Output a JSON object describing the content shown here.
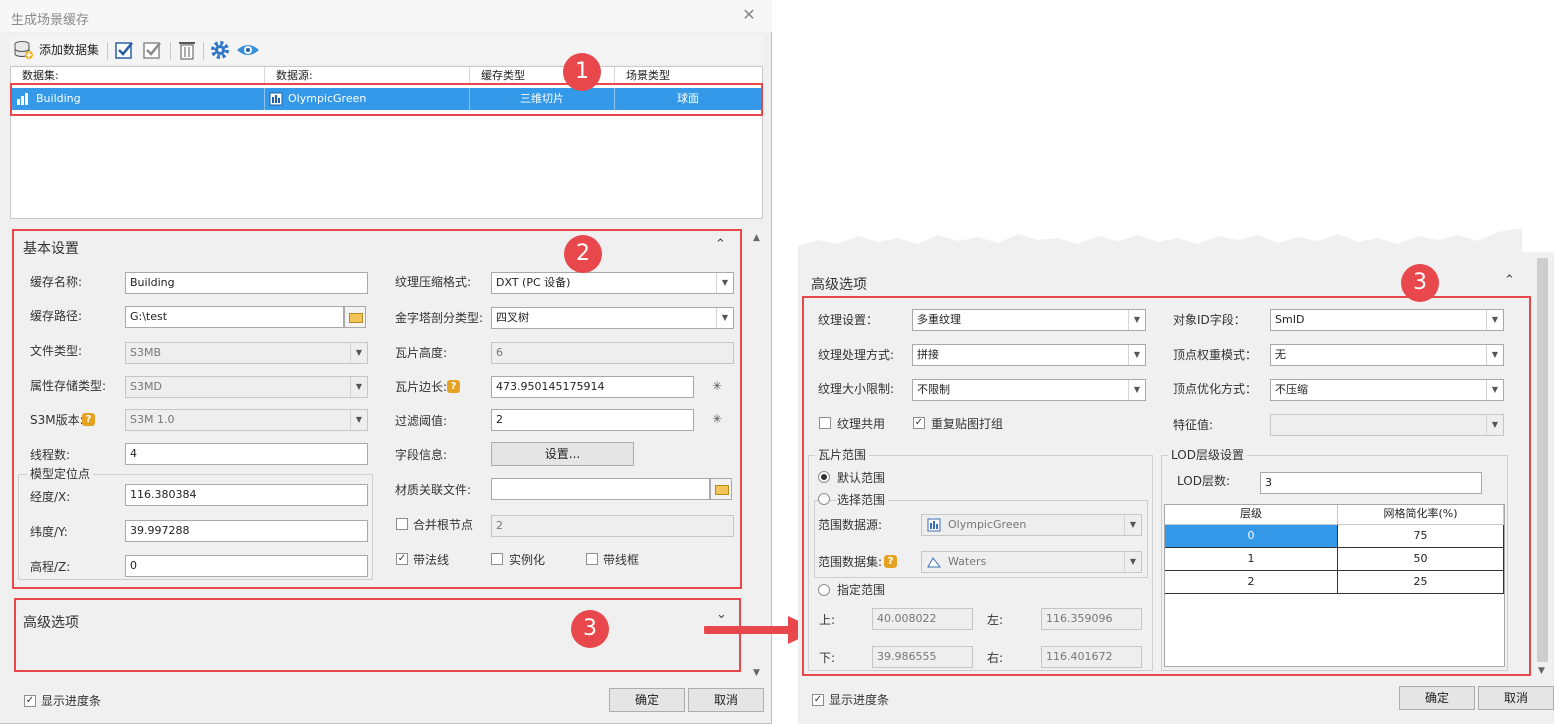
{
  "window": {
    "title": "生成场景缓存",
    "close_glyph": "✕"
  },
  "toolbar": {
    "add_dataset": "添加数据集"
  },
  "grid": {
    "headers": [
      "数据集:",
      "数据源:",
      "缓存类型",
      "场景类型"
    ],
    "row": {
      "dataset": "Building",
      "datasource": "OlympicGreen",
      "cache_type": "三维切片",
      "scene_type": "球面"
    }
  },
  "basic": {
    "title": "基本设置",
    "collapse": "⌃",
    "cache_name_label": "缓存名称:",
    "cache_name": "Building",
    "cache_path_label": "缓存路径:",
    "cache_path": "G:\\test",
    "file_type_label": "文件类型:",
    "file_type": "S3MB",
    "attr_storage_label": "属性存储类型:",
    "attr_storage": "S3MD",
    "s3m_version_label": "S3M版本:",
    "s3m_version": "S3M 1.0",
    "threads_label": "线程数:",
    "threads": "4",
    "model_pos_label": "模型定位点",
    "lon_label": "经度/X:",
    "lon": "116.380384",
    "lat_label": "纬度/Y:",
    "lat": "39.997288",
    "alt_label": "高程/Z:",
    "alt": "0",
    "tex_compress_label": "纹理压缩格式:",
    "tex_compress": "DXT (PC 设备)",
    "pyramid_label": "金字塔剖分类型:",
    "pyramid": "四叉树",
    "tile_height_label": "瓦片高度:",
    "tile_height": "6",
    "tile_edge_label": "瓦片边长:",
    "tile_edge": "473.950145175914",
    "filter_label": "过滤阈值:",
    "filter": "2",
    "field_info_label": "字段信息:",
    "field_button": "设置...",
    "material_label": "材质关联文件:",
    "material": "",
    "merge_root_label": "合并根节点",
    "merge_root_value": "2",
    "normal_label": "带法线",
    "instance_label": "实例化",
    "wireframe_label": "带线框",
    "star": "✳"
  },
  "advanced_collapsed": {
    "title": "高级选项",
    "expand": "⌄"
  },
  "footer": {
    "show_progress": "显示进度条",
    "ok": "确定",
    "cancel": "取消"
  },
  "advanced": {
    "title": "高级选项",
    "collapse": "⌃",
    "texture_setting_label": "纹理设置：",
    "texture_setting": "多重纹理",
    "texture_proc_label": "纹理处理方式:",
    "texture_proc": "拼接",
    "texture_size_label": "纹理大小限制:",
    "texture_size": "不限制",
    "texture_share_label": "纹理共用",
    "repeat_pack_label": "重复贴图打组",
    "object_id_label": "对象ID字段：",
    "object_id": "SmID",
    "vertex_weight_label": "顶点权重模式：",
    "vertex_weight": "无",
    "vertex_opt_label": "顶点优化方式：",
    "vertex_opt": "不压缩",
    "feature_label": "特征值:",
    "feature": "",
    "tile_range_title": "瓦片范围",
    "default_range": "默认范围",
    "select_range": "选择范围",
    "range_source_label": "范围数据源:",
    "range_source": "OlympicGreen",
    "range_dataset_label": "范围数据集:",
    "range_dataset": "Waters",
    "specify_range": "指定范围",
    "top_label": "上:",
    "top": "40.008022",
    "left_label": "左:",
    "left": "116.359096",
    "bottom_label": "下:",
    "bottom": "39.986555",
    "right_label": "右:",
    "right": "116.401672",
    "lod_title": "LOD层级设置",
    "lod_count_label": "LOD层数:",
    "lod_count": "3",
    "lod_headers": [
      "层级",
      "网格简化率(%)"
    ],
    "lod_rows": [
      [
        "0",
        "75"
      ],
      [
        "1",
        "50"
      ],
      [
        "2",
        "25"
      ]
    ]
  },
  "annotations": {
    "badge1": "1",
    "badge2": "2",
    "badge3": "3",
    "badge3b": "3"
  },
  "colors": {
    "highlight": "#e8474c",
    "selection": "#3399e8"
  }
}
